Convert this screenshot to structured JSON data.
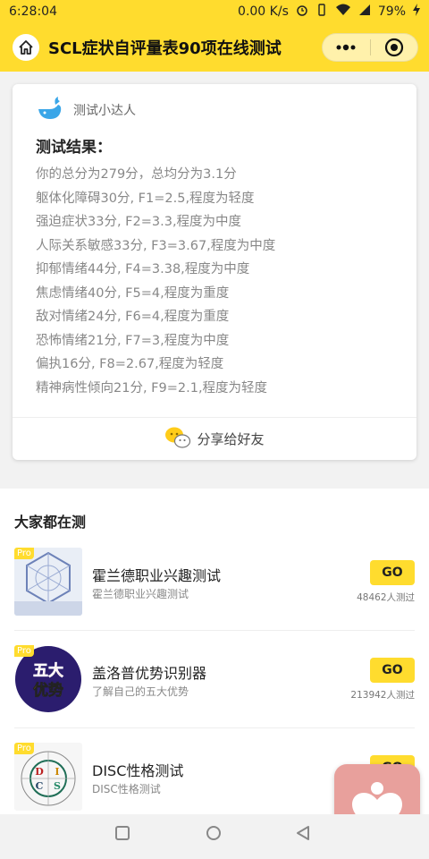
{
  "status": {
    "time": "6:28:04",
    "speed": "0.00 K/s",
    "battery": "79%"
  },
  "nav": {
    "title": "SCL症状自评量表90项在线测试"
  },
  "result": {
    "author": "测试小达人",
    "title": "测试结果：",
    "lines": [
      "你的总分为279分，总均分为3.1分",
      "躯体化障碍30分, F1=2.5,程度为轻度",
      "强迫症状33分, F2=3.3,程度为中度",
      "人际关系敏感33分, F3=3.67,程度为中度",
      "抑郁情绪44分, F4=3.38,程度为中度",
      "焦虑情绪40分, F5=4,程度为重度",
      "敌对情绪24分, F6=4,程度为重度",
      "恐怖情绪21分, F7=3,程度为中度",
      "偏执16分, F8=2.67,程度为轻度",
      "精神病性倾向21分, F9=2.1,程度为轻度"
    ],
    "share_label": "分享给好友"
  },
  "popular": {
    "title": "大家都在测",
    "items": [
      {
        "name": "霍兰德职业兴趣测试",
        "desc": "霍兰德职业兴趣测试",
        "go": "GO",
        "count": "48462人测过",
        "badge": "Pro"
      },
      {
        "name": "盖洛普优势识别器",
        "desc": "了解自己的五大优势",
        "go": "GO",
        "count": "213942人测过",
        "badge": "Pro",
        "thumb_text": [
          "五大",
          "优势"
        ]
      },
      {
        "name": "DISC性格测试",
        "desc": "DISC性格测试",
        "go": "GO",
        "count": "",
        "badge": "Pro",
        "thumb_text": [
          "D",
          "I",
          "S",
          "C"
        ]
      }
    ]
  },
  "colors": {
    "accent": "#ffdc2e",
    "fab": "#e8a09c"
  }
}
